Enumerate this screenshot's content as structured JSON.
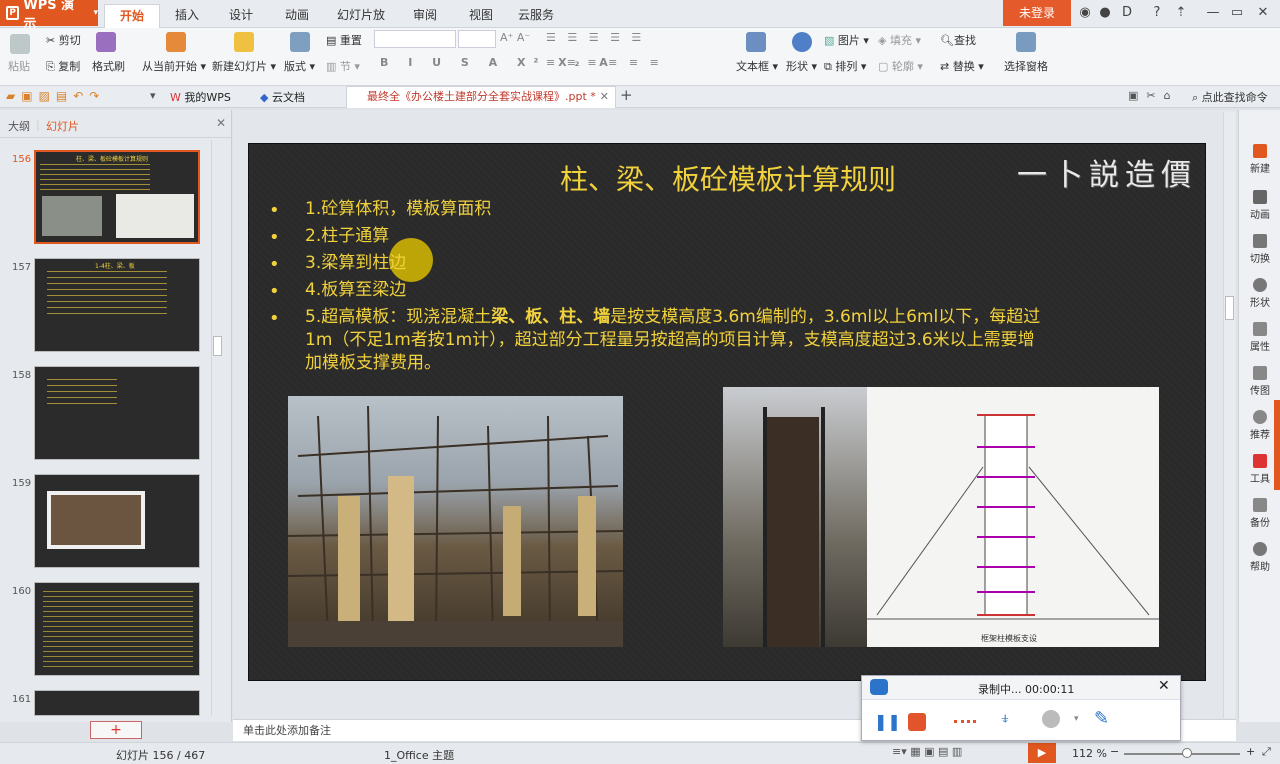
{
  "app": {
    "name": "WPS 演示",
    "login_label": "未登录"
  },
  "menu_tabs": [
    "开始",
    "插入",
    "设计",
    "动画",
    "幻灯片放映",
    "审阅",
    "视图",
    "云服务"
  ],
  "ribbon": {
    "paste": "粘贴",
    "cut": "剪切",
    "copy": "复制",
    "format_painter": "格式刷",
    "from_current": "从当前开始",
    "new_slide": "新建幻灯片",
    "layout": "版式",
    "reset": "重置",
    "section": "节",
    "text_box": "文本框",
    "shape": "形状",
    "picture": "图片",
    "fill": "填充",
    "arrange": "排列",
    "outline": "轮廓",
    "find": "查找",
    "replace": "替换",
    "select_pane": "选择窗格",
    "format_buttons": [
      "B",
      "I",
      "U",
      "S",
      "A",
      "X²",
      "X₂",
      "A"
    ]
  },
  "quick_bar": {
    "my_wps": "我的WPS",
    "cloud_doc": "云文档",
    "doc_tab": "最终全《办公楼土建部分全套实战课程》.ppt *",
    "find_cmd": "点此查找命令"
  },
  "left_panel": {
    "tab_outline": "大纲",
    "tab_slides": "幻灯片",
    "thumbs": [
      {
        "num": "156",
        "title": "柱、梁、板砼模板计算规则"
      },
      {
        "num": "157",
        "title": "1-4柱、梁、板"
      },
      {
        "num": "158",
        "title": ""
      },
      {
        "num": "159",
        "title": ""
      },
      {
        "num": "160",
        "title": ""
      },
      {
        "num": "161",
        "title": ""
      }
    ],
    "add_label": "+"
  },
  "slide": {
    "title": "柱、梁、板砼模板计算规则",
    "logo_text": "一卜説造價",
    "bullets": [
      "1.砼算体积，模板算面积",
      "2.柱子通算",
      "3.梁算到柱边",
      "4.板算至梁边"
    ],
    "bullet5_l1_a": "5.超高模板：现浇混凝土",
    "bullet5_l1_b": "梁、板、柱、墙",
    "bullet5_l1_c": "是按支模高度3.6m编制的，3.6ml以上6ml以下，每超过",
    "bullet5_l2": "1m（不足1m者按1m计），超过部分工程量另按超高的项目计算，支模高度超过3.6米以上需要增",
    "bullet5_l3": "加模板支撑费用。",
    "bullet_symbol": "•",
    "diagram_caption": "框架柱模板支设"
  },
  "right_panel": [
    "新建",
    "动画",
    "切换",
    "形状",
    "属性",
    "传图",
    "推荐",
    "工具",
    "备份",
    "帮助"
  ],
  "notes_placeholder": "单击此处添加备注",
  "status": {
    "slide_counter": "幻灯片 156 / 467",
    "theme": "1_Office 主题",
    "zoom": "112 %"
  },
  "recorder": {
    "status": "录制中... 00:00:11",
    "close": "✕"
  },
  "colors": {
    "accent": "#e0571f",
    "slide_text": "#f2d23c",
    "slide_bg": "#2a2a2a"
  }
}
